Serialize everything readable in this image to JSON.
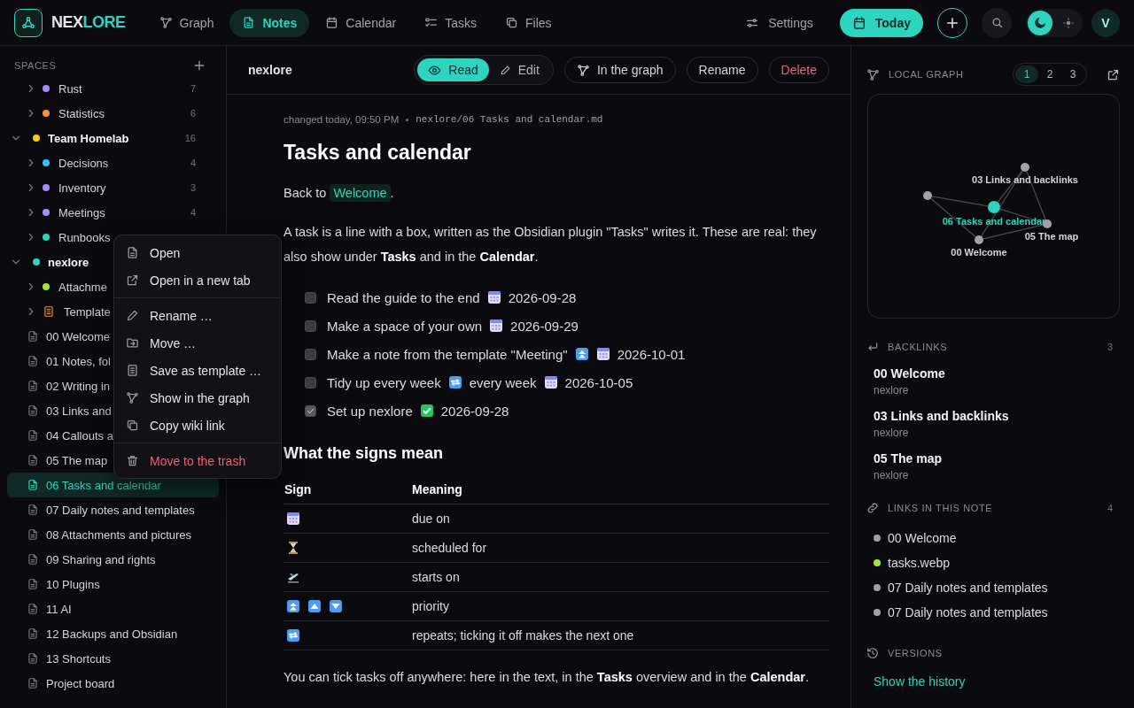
{
  "topbar": {
    "brand_first": "NEX",
    "brand_second": "LORE",
    "nav": [
      {
        "label": "Graph",
        "selected": false
      },
      {
        "label": "Notes",
        "selected": true
      },
      {
        "label": "Calendar",
        "selected": false
      },
      {
        "label": "Tasks",
        "selected": false
      },
      {
        "label": "Files",
        "selected": false
      }
    ],
    "settings": "Settings",
    "today": "Today",
    "theme_options": [
      {
        "kind": "dark",
        "selected": true
      },
      {
        "kind": "light",
        "selected": false
      }
    ],
    "avatar": "V"
  },
  "sidebar": {
    "heading": "SPACES",
    "tree": [
      {
        "kind": "folder",
        "label": "Rust",
        "color": "#a78bfa",
        "count": "7",
        "expanded": false
      },
      {
        "kind": "folder",
        "label": "Statistics",
        "color": "#fb923c",
        "count": "6",
        "expanded": false
      },
      {
        "kind": "space",
        "label": "Team Homelab",
        "color": "#facc15",
        "count": "16",
        "expanded": true,
        "children": [
          {
            "kind": "folder",
            "label": "Decisions",
            "color": "#38bdf8",
            "count": "4",
            "expanded": false
          },
          {
            "kind": "folder",
            "label": "Inventory",
            "color": "#a78bfa",
            "count": "3",
            "expanded": false
          },
          {
            "kind": "folder",
            "label": "Meetings",
            "color": "#a78bfa",
            "count": "4",
            "expanded": false
          },
          {
            "kind": "folder",
            "label": "Runbooks",
            "color": "#2dd4bf",
            "expanded": false
          }
        ]
      },
      {
        "kind": "space",
        "label": "nexlore",
        "color": "#2dd4bf",
        "expanded": true,
        "children": [
          {
            "kind": "folder",
            "label": "Attachme",
            "color": "#a3e635",
            "expanded": false
          },
          {
            "kind": "templates",
            "label": "Template",
            "expanded": false
          },
          {
            "kind": "note",
            "label": "00 Welcome",
            "selected": false
          },
          {
            "kind": "note",
            "label": "01 Notes, fol",
            "selected": false
          },
          {
            "kind": "note",
            "label": "02 Writing in",
            "selected": false
          },
          {
            "kind": "note",
            "label": "03 Links and",
            "selected": false
          },
          {
            "kind": "note",
            "label": "04 Callouts a",
            "selected": false
          },
          {
            "kind": "note",
            "label": "05 The map",
            "selected": false
          },
          {
            "kind": "note",
            "label": "06 Tasks and calendar",
            "selected": true
          },
          {
            "kind": "note",
            "label": "07 Daily notes and templates",
            "selected": false
          },
          {
            "kind": "note",
            "label": "08 Attachments and pictures",
            "selected": false
          },
          {
            "kind": "note",
            "label": "09 Sharing and rights",
            "selected": false
          },
          {
            "kind": "note",
            "label": "10 Plugins",
            "selected": false
          },
          {
            "kind": "note",
            "label": "11 AI",
            "selected": false
          },
          {
            "kind": "note",
            "label": "12 Backups and Obsidian",
            "selected": false
          },
          {
            "kind": "note",
            "label": "13 Shortcuts",
            "selected": false
          },
          {
            "kind": "note",
            "label": "Project board",
            "selected": false
          }
        ]
      }
    ]
  },
  "context_menu": {
    "groups": [
      [
        {
          "label": "Open",
          "kind": "normal"
        },
        {
          "label": "Open in a new tab",
          "kind": "normal"
        }
      ],
      [
        {
          "label": "Rename …",
          "kind": "normal"
        },
        {
          "label": "Move …",
          "kind": "normal"
        },
        {
          "label": "Save as template …",
          "kind": "normal"
        },
        {
          "label": "Show in the graph",
          "kind": "normal"
        },
        {
          "label": "Copy wiki link",
          "kind": "normal"
        }
      ],
      [
        {
          "label": "Move to the trash",
          "kind": "danger"
        }
      ]
    ]
  },
  "note_toolbar": {
    "title": "nexlore",
    "modes": [
      {
        "label": "Read",
        "selected": true
      },
      {
        "label": "Edit",
        "selected": false
      }
    ],
    "buttons": [
      {
        "label": "In the graph",
        "kind": "graph"
      },
      {
        "label": "Rename",
        "kind": "normal"
      },
      {
        "label": "Delete",
        "kind": "danger"
      }
    ]
  },
  "note": {
    "changed": "changed today, 09:50 PM",
    "path": "nexlore/06 Tasks and calendar.md",
    "title": "Tasks and calendar",
    "back": {
      "prefix": "Back to",
      "link": "Welcome",
      "suffix": "."
    },
    "intro": "A task is a line with a box, written as the Obsidian plugin \"Tasks\" writes it. These are real: they also show under **Tasks** and in the **Calendar**.",
    "tasks": [
      {
        "checked": false,
        "parts": [
          {
            "kind": "text",
            "text": "Read the guide to the end"
          },
          {
            "kind": "due"
          },
          {
            "kind": "text",
            "text": "2026-09-28"
          }
        ]
      },
      {
        "checked": false,
        "parts": [
          {
            "kind": "text",
            "text": "Make a space of your own"
          },
          {
            "kind": "due"
          },
          {
            "kind": "text",
            "text": "2026-09-29"
          }
        ]
      },
      {
        "checked": false,
        "parts": [
          {
            "kind": "text",
            "text": "Make a note from the template \"Meeting\""
          },
          {
            "kind": "highest"
          },
          {
            "kind": "due"
          },
          {
            "kind": "text",
            "text": "2026-10-01"
          }
        ]
      },
      {
        "checked": false,
        "parts": [
          {
            "kind": "text",
            "text": "Tidy up every week"
          },
          {
            "kind": "repeat"
          },
          {
            "kind": "text",
            "text": "every week"
          },
          {
            "kind": "due"
          },
          {
            "kind": "text",
            "text": "2026-10-05"
          }
        ]
      },
      {
        "checked": true,
        "parts": [
          {
            "kind": "text",
            "text": "Set up nexlore"
          },
          {
            "kind": "done"
          },
          {
            "kind": "text",
            "text": "2026-09-28"
          }
        ]
      }
    ],
    "signs_heading": "What the signs mean",
    "table": {
      "columns": [
        "Sign",
        "Meaning"
      ],
      "rows": [
        {
          "kind": "due",
          "meaning": "due on"
        },
        {
          "kind": "scheduled",
          "meaning": "scheduled for"
        },
        {
          "kind": "start",
          "meaning": "starts on"
        },
        {
          "kind": "priority",
          "meaning": "priority"
        },
        {
          "kind": "repeat",
          "meaning": "repeats; ticking it off makes the next one"
        }
      ]
    },
    "outro": "You can tick tasks off anywhere: here in the text, in the **Tasks** overview and in the **Calendar**."
  },
  "right_panel": {
    "graph_heading": "LOCAL GRAPH",
    "depths": [
      {
        "label": "1",
        "selected": true
      },
      {
        "label": "2",
        "selected": false
      },
      {
        "label": "3",
        "selected": false
      }
    ],
    "graph_nodes": [
      {
        "selected": false
      },
      {
        "label": "03 Links and backlinks",
        "selected": false
      },
      {
        "label": "06 Tasks and calendar",
        "selected": true
      },
      {
        "label": "05 The map",
        "selected": false
      },
      {
        "label": "00 Welcome",
        "selected": false
      }
    ],
    "backlinks_heading": "BACKLINKS",
    "backlinks_count": "3",
    "backlinks": [
      {
        "title": "00 Welcome",
        "space": "nexlore"
      },
      {
        "title": "03 Links and backlinks",
        "space": "nexlore"
      },
      {
        "title": "05 The map",
        "space": "nexlore"
      }
    ],
    "links_heading": "LINKS IN THIS NOTE",
    "links_count": "4",
    "links": [
      {
        "label": "00 Welcome",
        "color": "#a1a1aa"
      },
      {
        "label": "tasks.webp",
        "color": "#a3e635"
      },
      {
        "label": "07 Daily notes and templates",
        "color": "#a1a1aa"
      },
      {
        "label": "07 Daily notes and templates",
        "color": "#a1a1aa"
      }
    ],
    "versions_heading": "VERSIONS",
    "history_link": "Show the history"
  }
}
